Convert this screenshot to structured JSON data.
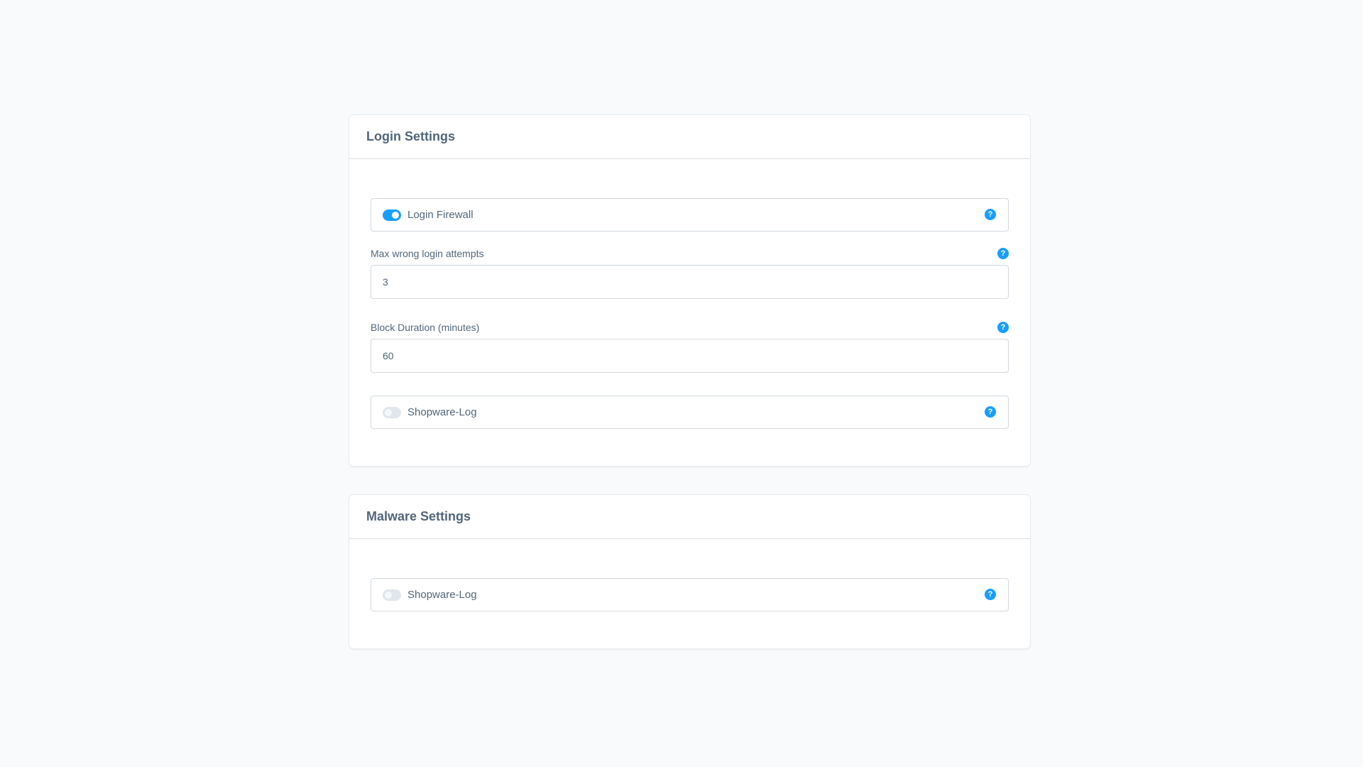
{
  "login_settings": {
    "title": "Login Settings",
    "login_firewall": {
      "label": "Login Firewall",
      "enabled": true
    },
    "max_attempts": {
      "label": "Max wrong login attempts",
      "value": "3"
    },
    "block_duration": {
      "label": "Block Duration (minutes)",
      "value": "60"
    },
    "shopware_log": {
      "label": "Shopware-Log",
      "enabled": false
    }
  },
  "malware_settings": {
    "title": "Malware Settings",
    "shopware_log": {
      "label": "Shopware-Log",
      "enabled": false
    }
  },
  "help_icon_glyph": "?",
  "colors": {
    "accent": "#189eff",
    "background": "#f9fafb",
    "text": "#52667a",
    "border": "#d1d9e0"
  }
}
